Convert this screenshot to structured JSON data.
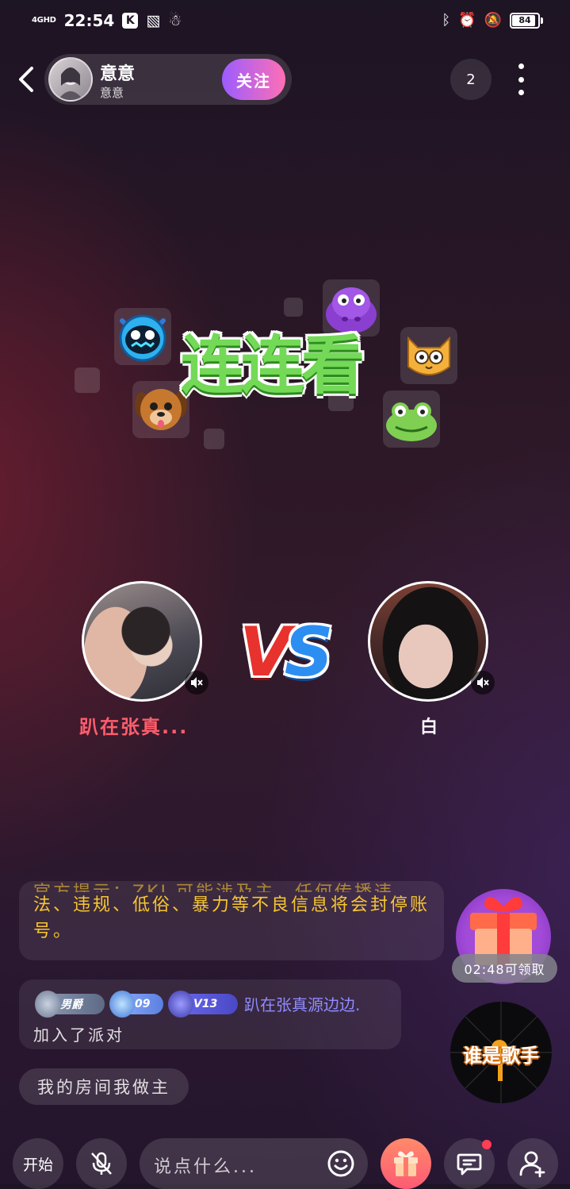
{
  "status_bar": {
    "network": "4GHD",
    "time": "22:54",
    "app_badge_1": "K",
    "battery": "84",
    "battery_level": 0.84
  },
  "header": {
    "host_name": "意意",
    "host_id": "意意",
    "follow_label": "关注",
    "online_count": "2"
  },
  "game": {
    "title": "连连看"
  },
  "players": {
    "left_name": "趴在张真...",
    "right_name": "白",
    "vs": "VS"
  },
  "chat": {
    "notice_partial": "官方提示：ZKJ 可能涉及主、任何传播违",
    "notice": "法、违规、低俗、暴力等不良信息将会封停账号。",
    "join_badges": {
      "gender_title": "男爵",
      "level": "09",
      "vip": "V13"
    },
    "join_user": "趴在张真源边边.",
    "join_text": "加入了派对",
    "room_motto": "我的房间我做主"
  },
  "widgets": {
    "gift_timer": "02:48可领取",
    "event_title": "谁是歌手"
  },
  "bottom_bar": {
    "start_label": "开始",
    "input_placeholder": "说点什么..."
  },
  "colors": {
    "accent_purple": "#9b5cff",
    "accent_pink": "#ff6fb5",
    "notice_yellow": "#f7c62f",
    "player_red": "#ff5d6c"
  }
}
